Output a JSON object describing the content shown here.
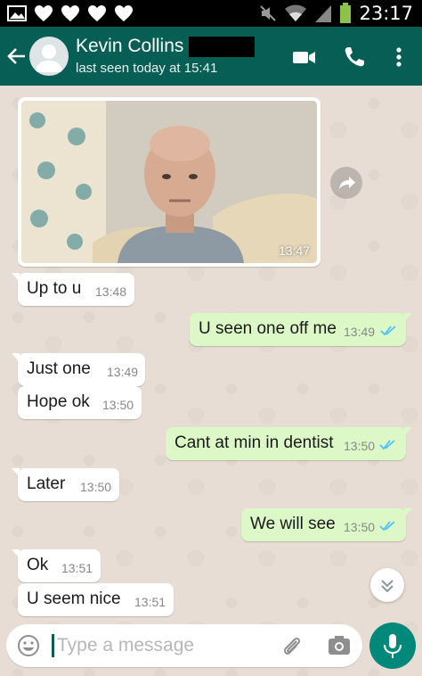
{
  "status_bar": {
    "time": "23:17",
    "icons": [
      "image-icon",
      "heart-icon",
      "heart-icon",
      "heart-icon",
      "heart-icon",
      "mute-icon",
      "wifi-icon",
      "signal-icon",
      "battery-icon"
    ]
  },
  "header": {
    "contact_name": "Kevin Collins",
    "last_seen": "last seen today at 15:41",
    "icons": [
      "back-arrow-icon",
      "avatar",
      "video-call-icon",
      "phone-icon",
      "more-vert-icon"
    ]
  },
  "chat": {
    "image_message": {
      "time": "13:47"
    },
    "messages": [
      {
        "dir": "in",
        "text": "Up to u",
        "time": "13:48"
      },
      {
        "dir": "out",
        "text": "U seen one off me",
        "time": "13:49",
        "read": true
      },
      {
        "dir": "in",
        "text": "Just one",
        "time": "13:49"
      },
      {
        "dir": "in",
        "text": "Hope ok",
        "time": "13:50"
      },
      {
        "dir": "out",
        "text": "Cant at min in dentist",
        "time": "13:50",
        "read": true
      },
      {
        "dir": "in",
        "text": "Later",
        "time": "13:50"
      },
      {
        "dir": "out",
        "text": "We will see",
        "time": "13:50",
        "read": true
      },
      {
        "dir": "in",
        "text": "Ok",
        "time": "13:51"
      },
      {
        "dir": "in",
        "text": "U seem nice",
        "time": "13:51"
      }
    ]
  },
  "input": {
    "placeholder": "Type a message"
  },
  "colors": {
    "header": "#075e54",
    "outgoing_bubble": "#dcf8c6",
    "incoming_bubble": "#ffffff",
    "read_ticks": "#4fc3f7",
    "mic_button": "#00897b",
    "chat_background": "#e7ddd4"
  }
}
